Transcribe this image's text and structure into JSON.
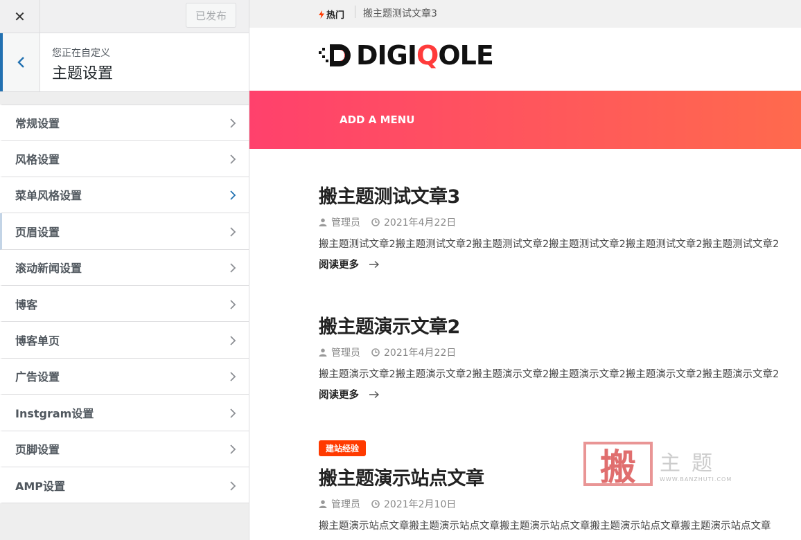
{
  "sidebar": {
    "publish_label": "已发布",
    "info_sub": "您正在自定义",
    "info_title": "主题设置",
    "items": [
      {
        "label": "常规设置",
        "active": false
      },
      {
        "label": "风格设置",
        "active": false
      },
      {
        "label": "菜单风格设置",
        "active": false
      },
      {
        "label": "页眉设置",
        "active": true
      },
      {
        "label": "滚动新闻设置",
        "active": false
      },
      {
        "label": "博客",
        "active": false
      },
      {
        "label": "博客单页",
        "active": false
      },
      {
        "label": "广告设置",
        "active": false
      },
      {
        "label": "Instgram设置",
        "active": false
      },
      {
        "label": "页脚设置",
        "active": false
      },
      {
        "label": "AMP设置",
        "active": false
      }
    ]
  },
  "preview": {
    "trending_label": "热门",
    "trending_title": "搬主题测试文章3",
    "logo_text": "DIGIQOLE",
    "menu_label": "ADD A MENU",
    "posts": [
      {
        "badge": "",
        "title": "搬主题测试文章3",
        "author": "管理员",
        "date": "2021年4月22日",
        "excerpt": "搬主题测试文章2搬主题测试文章2搬主题测试文章2搬主题测试文章2搬主题测试文章2搬主题测试文章2",
        "more": "阅读更多"
      },
      {
        "badge": "",
        "title": "搬主题演示文章2",
        "author": "管理员",
        "date": "2021年4月22日",
        "excerpt": "搬主题演示文章2搬主题演示文章2搬主题演示文章2搬主题演示文章2搬主题演示文章2搬主题演示文章2",
        "more": "阅读更多"
      },
      {
        "badge": "建站经验",
        "title": "搬主题演示站点文章",
        "author": "管理员",
        "date": "2021年2月10日",
        "excerpt": "搬主题演示站点文章搬主题演示站点文章搬主题演示站点文章搬主题演示站点文章搬主题演示站点文章",
        "more": "阅读更多"
      }
    ],
    "watermark": {
      "seal": "搬",
      "text": "主题",
      "url": "WWW.BANZHUTI.COM"
    }
  },
  "colors": {
    "accent": "#2271b1",
    "menu_gradient_start": "#ff416c",
    "menu_gradient_end": "#ff6a4d",
    "badge": "#ff3a00"
  }
}
